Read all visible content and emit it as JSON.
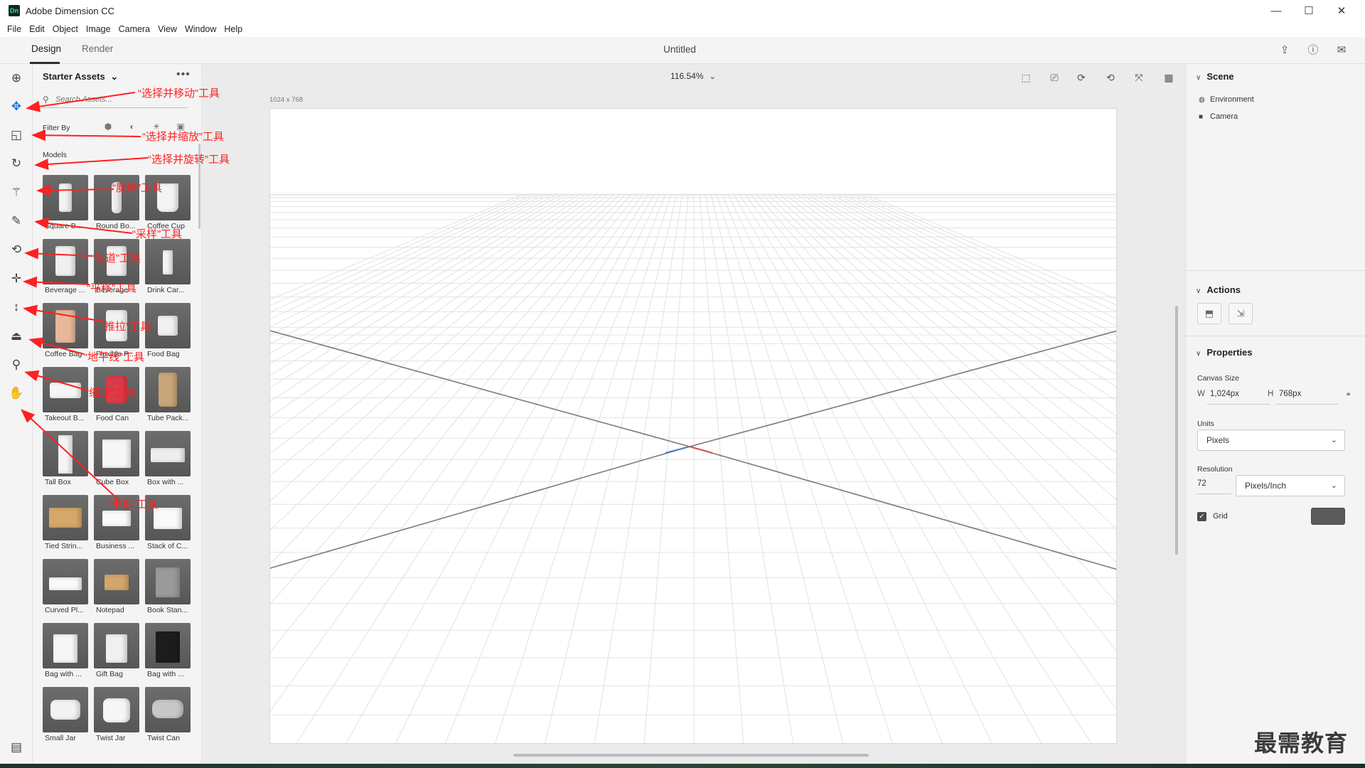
{
  "app": {
    "title": "Adobe Dimension CC",
    "logo_text": "Dn",
    "window_controls": [
      "—",
      "☐",
      "✕"
    ]
  },
  "menu": [
    "File",
    "Edit",
    "Object",
    "Image",
    "Camera",
    "View",
    "Window",
    "Help"
  ],
  "tabs": {
    "design": "Design",
    "render": "Render"
  },
  "document_title": "Untitled",
  "toolbar": {
    "tools": [
      {
        "name": "add-content-icon",
        "glyph": "⊕"
      },
      {
        "name": "select-move-icon",
        "glyph": "✥"
      },
      {
        "name": "select-scale-icon",
        "glyph": "◱"
      },
      {
        "name": "select-rotate-icon",
        "glyph": "↻"
      },
      {
        "name": "magic-wand-icon",
        "glyph": "⚚"
      },
      {
        "name": "eyedropper-icon",
        "glyph": "✎"
      },
      {
        "name": "orbit-icon",
        "glyph": "⟲"
      },
      {
        "name": "pan-icon",
        "glyph": "✛"
      },
      {
        "name": "dolly-icon",
        "glyph": "↕"
      },
      {
        "name": "horizon-icon",
        "glyph": "⏏"
      },
      {
        "name": "zoom-icon",
        "glyph": "⚲"
      },
      {
        "name": "hand-icon",
        "glyph": "✋"
      }
    ],
    "bottom_glyph": "▤"
  },
  "assets": {
    "header": "Starter Assets",
    "header_chevron": "⌄",
    "more": "•••",
    "search_placeholder": "Search Assets...",
    "filter_label": "Filter By",
    "section": "Models",
    "items": [
      {
        "label": "Square B...",
        "shape": "bottle"
      },
      {
        "label": "Round Bo...",
        "shape": "bottle-round"
      },
      {
        "label": "Coffee Cup",
        "shape": "cup"
      },
      {
        "label": "Beverage ...",
        "shape": "cup-lid"
      },
      {
        "label": "Beverage ...",
        "shape": "cup-lid"
      },
      {
        "label": "Drink Car...",
        "shape": "carton"
      },
      {
        "label": "Coffee Bag",
        "shape": "bag-pink"
      },
      {
        "label": "Flexible Pou...",
        "shape": "pouch"
      },
      {
        "label": "Food Bag",
        "shape": "foodbag"
      },
      {
        "label": "Takeout B...",
        "shape": "takeout"
      },
      {
        "label": "Food Can",
        "shape": "can-red"
      },
      {
        "label": "Tube Pack...",
        "shape": "tube"
      },
      {
        "label": "Tall Box",
        "shape": "tallbox"
      },
      {
        "label": "Cube Box",
        "shape": "cube"
      },
      {
        "label": "Box with ...",
        "shape": "flatbox"
      },
      {
        "label": "Tied Strin...",
        "shape": "parcel"
      },
      {
        "label": "Business ...",
        "shape": "cards"
      },
      {
        "label": "Stack of C...",
        "shape": "stack"
      },
      {
        "label": "Curved Pl...",
        "shape": "paper"
      },
      {
        "label": "Notepad",
        "shape": "notepad"
      },
      {
        "label": "Book Stan...",
        "shape": "book"
      },
      {
        "label": "Bag with ...",
        "shape": "bag-white"
      },
      {
        "label": "Gift Bag",
        "shape": "bag-gift"
      },
      {
        "label": "Bag with ...",
        "shape": "bag-black"
      },
      {
        "label": "Small Jar",
        "shape": "jar"
      },
      {
        "label": "Twist Jar",
        "shape": "twistjar"
      },
      {
        "label": "Twist Can",
        "shape": "twistcan"
      }
    ]
  },
  "viewport": {
    "zoom": "116.54%",
    "zoom_chevron": "⌄",
    "canvas_size_label": "1024 x 768"
  },
  "right_panel": {
    "scene": {
      "title": "Scene",
      "items": [
        {
          "label": "Environment",
          "icon": "environment-icon",
          "glyph": "◍"
        },
        {
          "label": "Camera",
          "icon": "camera-icon",
          "glyph": "■"
        }
      ]
    },
    "actions": {
      "title": "Actions"
    },
    "properties": {
      "title": "Properties",
      "canvas_size_label": "Canvas Size",
      "w_label": "W",
      "w_value": "1,024px",
      "h_label": "H",
      "h_value": "768px",
      "units_label": "Units",
      "units_value": "Pixels",
      "resolution_label": "Resolution",
      "resolution_value": "72",
      "resolution_unit": "Pixels/Inch",
      "grid_label": "Grid",
      "grid_checked": true,
      "grid_color": "#5a5a5a"
    }
  },
  "annotations": [
    "“选择并移动”工具",
    "“选择并缩放”工具",
    "“选择并旋转”工具",
    "“魔棒”工具",
    "“采样”工具",
    "“轨道”工具",
    "“平移”工具",
    "“推拉”工具",
    "“地平线”工具",
    "“缩放”工具",
    "“手形”工具"
  ],
  "watermark": "最需教育"
}
